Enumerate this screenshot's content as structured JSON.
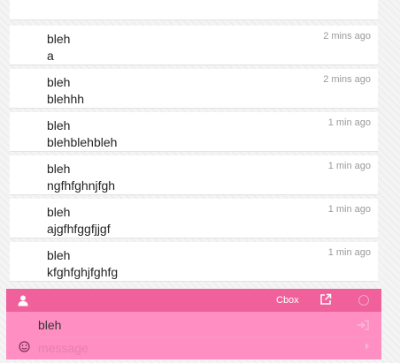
{
  "messages": [
    {
      "name": "bleh",
      "text": "a",
      "time": "2 mins ago"
    },
    {
      "name": "bleh",
      "text": "blehhh",
      "time": "2 mins ago"
    },
    {
      "name": "bleh",
      "text": "blehblehbleh",
      "time": "1 min ago"
    },
    {
      "name": "bleh",
      "text": "ngfhfghnjfgh",
      "time": "1 min ago"
    },
    {
      "name": "bleh",
      "text": "ajgfhfggfjjgf",
      "time": "1 min ago"
    },
    {
      "name": "bleh",
      "text": "kfghfghjfghfg",
      "time": "1 min ago"
    }
  ],
  "toolbar": {
    "brand": "Cbox"
  },
  "form": {
    "name_value": "bleh",
    "message_placeholder": "message"
  },
  "icons": {
    "user": "user-icon",
    "popout": "popout-icon",
    "circle": "circle-icon",
    "login": "sign-in-icon",
    "smiley": "smiley-icon",
    "send": "caret-right-icon"
  },
  "colors": {
    "bar": "#f0609a",
    "form": "#ff8ec3"
  }
}
